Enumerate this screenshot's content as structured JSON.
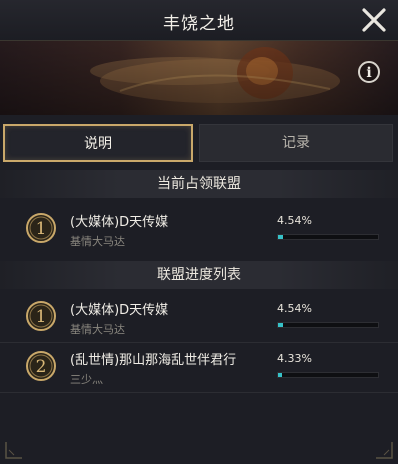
{
  "window": {
    "title": "丰饶之地"
  },
  "tabs": [
    {
      "label": "说明",
      "active": true
    },
    {
      "label": "记录",
      "active": false
    }
  ],
  "occupying": {
    "header": "当前占领联盟",
    "rows": [
      {
        "rank": "1",
        "alliance": "(大媒体)D天传媒",
        "leader": "基情大马达",
        "percent_text": "4.54%",
        "progress": 0.0454
      }
    ]
  },
  "progress_list": {
    "header": "联盟进度列表",
    "rows": [
      {
        "rank": "1",
        "alliance": "(大媒体)D天传媒",
        "leader": "基情大马达",
        "percent_text": "4.54%",
        "progress": 0.0454
      },
      {
        "rank": "2",
        "alliance": "(乱世情)那山那海乱世伴君行",
        "leader": "三少灬",
        "percent_text": "4.33%",
        "progress": 0.0433
      }
    ]
  },
  "colors": {
    "accent_gold": "#c9a86a",
    "progress": "#37c2c8"
  },
  "icons": {
    "close": "close-icon",
    "info": "info-icon",
    "rank": "rank-medal-icon"
  }
}
